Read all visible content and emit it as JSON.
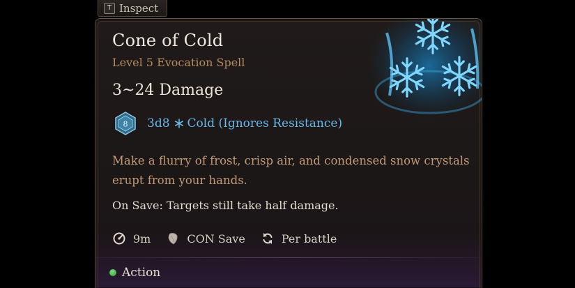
{
  "inspect_tab": {
    "key": "T",
    "label": "Inspect"
  },
  "spell": {
    "name": "Cone of Cold",
    "subtitle": "Level 5 Evocation Spell",
    "damage_summary": "3~24 Damage",
    "die_face": "8",
    "damage_dice": "3d8",
    "damage_type": "Cold (Ignores Resistance)",
    "description": "Make a flurry of frost, crisp air, and condensed snow crystals erupt from your hands.",
    "save_note": "On Save: Targets still take half damage.",
    "range": "9m",
    "save": "CON Save",
    "recharge": "Per battle",
    "action_cost": "Action",
    "art_icon": "snowflake-cone-icon"
  },
  "colors": {
    "title": "#f1e9de",
    "subtitle": "#b38a5d",
    "damage_blue": "#68b8e8",
    "description": "#c49a76",
    "border": "#6b5538",
    "action_green": "#3fbf45"
  }
}
